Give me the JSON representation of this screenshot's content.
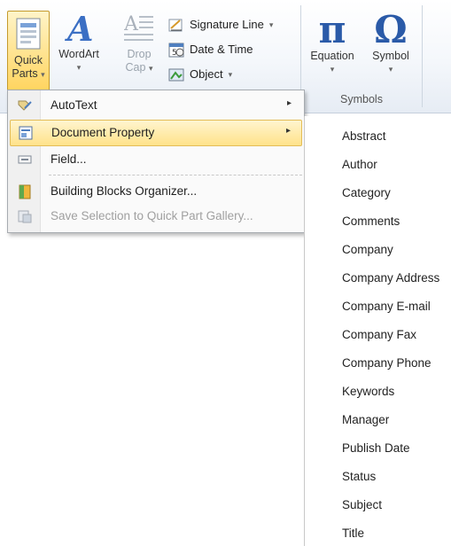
{
  "ribbon": {
    "quick_parts": {
      "line1": "Quick",
      "line2": "Parts",
      "arrow": "▾"
    },
    "wordart": {
      "label": "WordArt",
      "arrow": "▾"
    },
    "drop_cap": {
      "line1": "Drop",
      "line2": "Cap",
      "arrow": "▾"
    },
    "signature_line": {
      "label": "Signature Line",
      "arrow": "▾"
    },
    "date_time": {
      "label": "Date & Time"
    },
    "object": {
      "label": "Object",
      "arrow": "▾"
    },
    "equation": {
      "label": "Equation",
      "glyph": "π",
      "arrow": "▾"
    },
    "symbol": {
      "label": "Symbol",
      "glyph": "Ω",
      "arrow": "▾"
    },
    "symbols_group_label": "Symbols"
  },
  "menu": {
    "items": [
      {
        "label": "AutoText",
        "icon": "autotext-icon",
        "arrow": "▸"
      },
      {
        "label": "Document Property",
        "icon": "document-property-icon",
        "arrow": "▸"
      },
      {
        "label": "Field...",
        "icon": "field-icon"
      },
      {
        "label": "Building Blocks Organizer...",
        "icon": "building-blocks-icon"
      },
      {
        "label": "Save Selection to Quick Part Gallery...",
        "icon": "save-selection-icon"
      }
    ]
  },
  "submenu": {
    "items": [
      "Abstract",
      "Author",
      "Category",
      "Comments",
      "Company",
      "Company Address",
      "Company E-mail",
      "Company Fax",
      "Company Phone",
      "Keywords",
      "Manager",
      "Publish Date",
      "Status",
      "Subject",
      "Title"
    ]
  },
  "colors": {
    "highlight": "#ffe28a",
    "accent_blue": "#2a5aa8"
  }
}
